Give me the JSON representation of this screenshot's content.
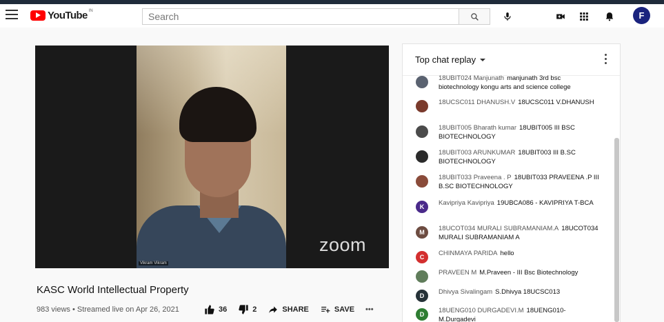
{
  "header": {
    "logo_text": "YouTube",
    "logo_region": "IN",
    "search_placeholder": "Search",
    "avatar_letter": "F"
  },
  "video": {
    "title": "KASC World Intellectual Property",
    "meta": "983 views • Streamed live on Apr 26, 2021",
    "watermark": "zoom",
    "participant_name": "Vikram Vikram",
    "likes": "36",
    "dislikes": "2",
    "share_label": "SHARE",
    "save_label": "SAVE",
    "more_label": "•••"
  },
  "chat": {
    "header_title": "Top chat replay",
    "messages": [
      {
        "author": "18UBIT024 Manjunath",
        "text": "manjunath 3rd bsc biotechnology kongu arts and science college",
        "avatar": "",
        "color": "#5a6270"
      },
      {
        "author": "18UCSC011 DHANUSH.V",
        "text": "18UCSC011 V.DHANUSH",
        "avatar": "",
        "color": "#7a3a2c"
      },
      {
        "author": "18UBIT005 Bharath kumar",
        "text": "18UBIT005 III BSC BIOTECHNOLOGY",
        "avatar": "",
        "color": "#4b4b4b"
      },
      {
        "author": "18UBIT003 ARUNKUMAR",
        "text": "18UBIT003 III B.SC BIOTECHNOLOGY",
        "avatar": "",
        "color": "#2b2b2b"
      },
      {
        "author": "18UBIT033 Praveena . P",
        "text": "18UBIT033 PRAVEENA .P III B.SC BIOTECHNOLOGY",
        "avatar": "",
        "color": "#8a4b3a"
      },
      {
        "author": "Kavipriya Kavipriya",
        "text": "19UBCA086 - KAVIPRIYA T-BCA",
        "avatar": "K",
        "color": "#4a2a8a"
      },
      {
        "author": "18UCOT034 MURALI SUBRAMANIAM.A",
        "text": "18UCOT034 MURALI SUBRAMANIAM A",
        "avatar": "M",
        "color": "#6d4c41"
      },
      {
        "author": "CHINMAYA PARIDA",
        "text": "hello",
        "avatar": "C",
        "color": "#d32f2f"
      },
      {
        "author": "PRAVEEN M",
        "text": "M.Praveen - III Bsc Biotechnology",
        "avatar": "",
        "color": "#607d5b"
      },
      {
        "author": "Dhivya Sivalingam",
        "text": "S.Dhivya 18UCSC013",
        "avatar": "D",
        "color": "#263238"
      },
      {
        "author": "18UENG010 DURGADEVI.M",
        "text": "18UENG010-M.Durgadevi",
        "avatar": "D",
        "color": "#2e7d32"
      }
    ]
  }
}
